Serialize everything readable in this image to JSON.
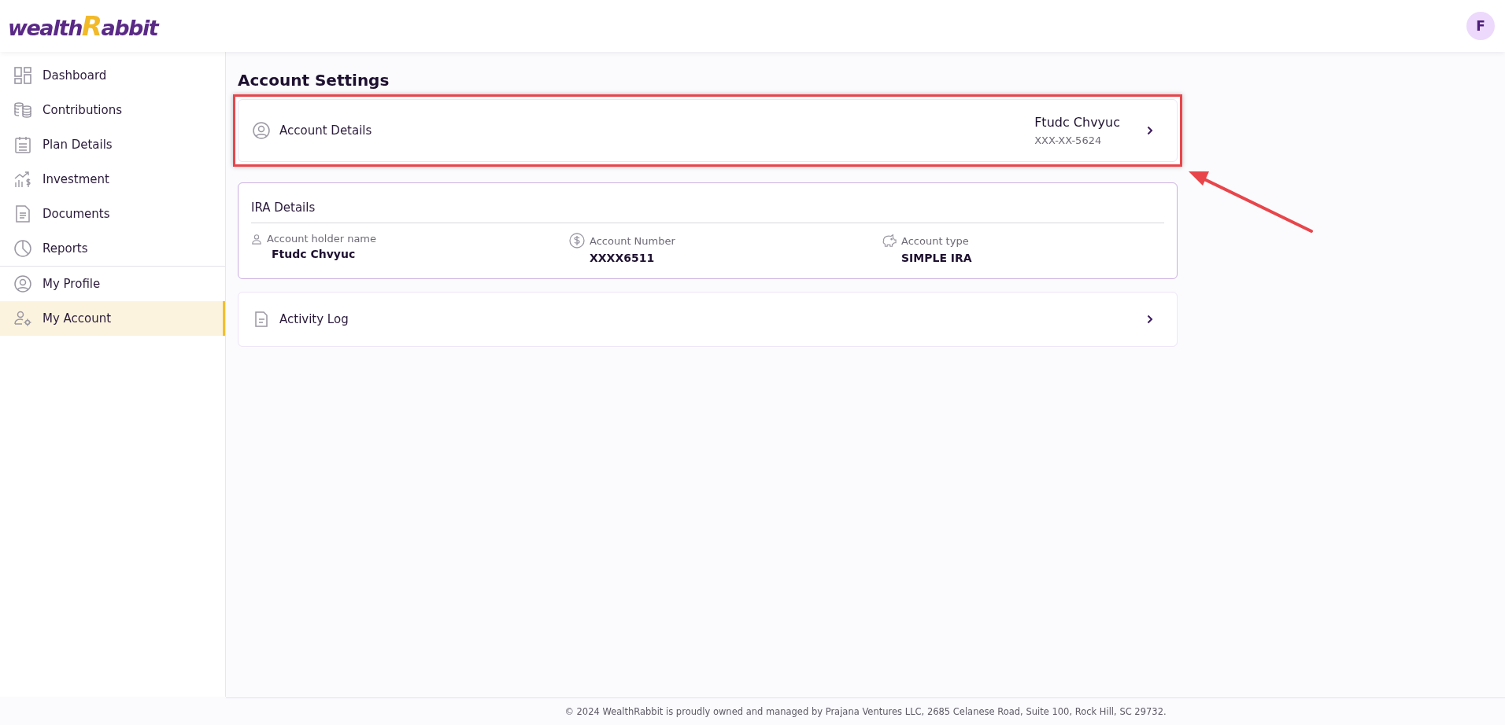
{
  "header": {
    "logo_parts": [
      "wealth",
      "R",
      "abbit"
    ],
    "avatar": "F"
  },
  "sidebar": {
    "sections": [
      {
        "items": [
          {
            "label": "Dashboard",
            "kind": "grid",
            "selected": false
          },
          {
            "label": "Contributions",
            "kind": "coins",
            "selected": false
          },
          {
            "label": "Plan Details",
            "kind": "clipboard",
            "selected": false
          },
          {
            "label": "Investment",
            "kind": "chart",
            "selected": false
          },
          {
            "label": "Documents",
            "kind": "doc",
            "selected": false
          },
          {
            "label": "Reports",
            "kind": "pie",
            "selected": false
          }
        ]
      },
      {
        "items": [
          {
            "label": "My Profile",
            "kind": "profile",
            "selected": false
          },
          {
            "label": "My Account",
            "kind": "account",
            "selected": true
          }
        ]
      }
    ]
  },
  "page_title": "Account Settings",
  "account_details": {
    "label": "Account Details",
    "name": "Ftudc Chvyuc",
    "ssn": "XXX-XX-5624"
  },
  "ira_details": {
    "title": "IRA Details",
    "fields": [
      {
        "label": "Account holder name",
        "value": "Ftudc Chvyuc",
        "kind": "holder"
      },
      {
        "label": "Account Number",
        "value": "XXXX6511",
        "kind": "number"
      },
      {
        "label": "Account type",
        "value": "SIMPLE IRA",
        "kind": "type"
      }
    ]
  },
  "activity_log": {
    "label": "Activity Log"
  },
  "footer": "© 2024 WealthRabbit is proudly owned and managed by Prajana Ventures LLC, 2685 Celanese Road, Suite 100, Rock Hill, SC 29732."
}
